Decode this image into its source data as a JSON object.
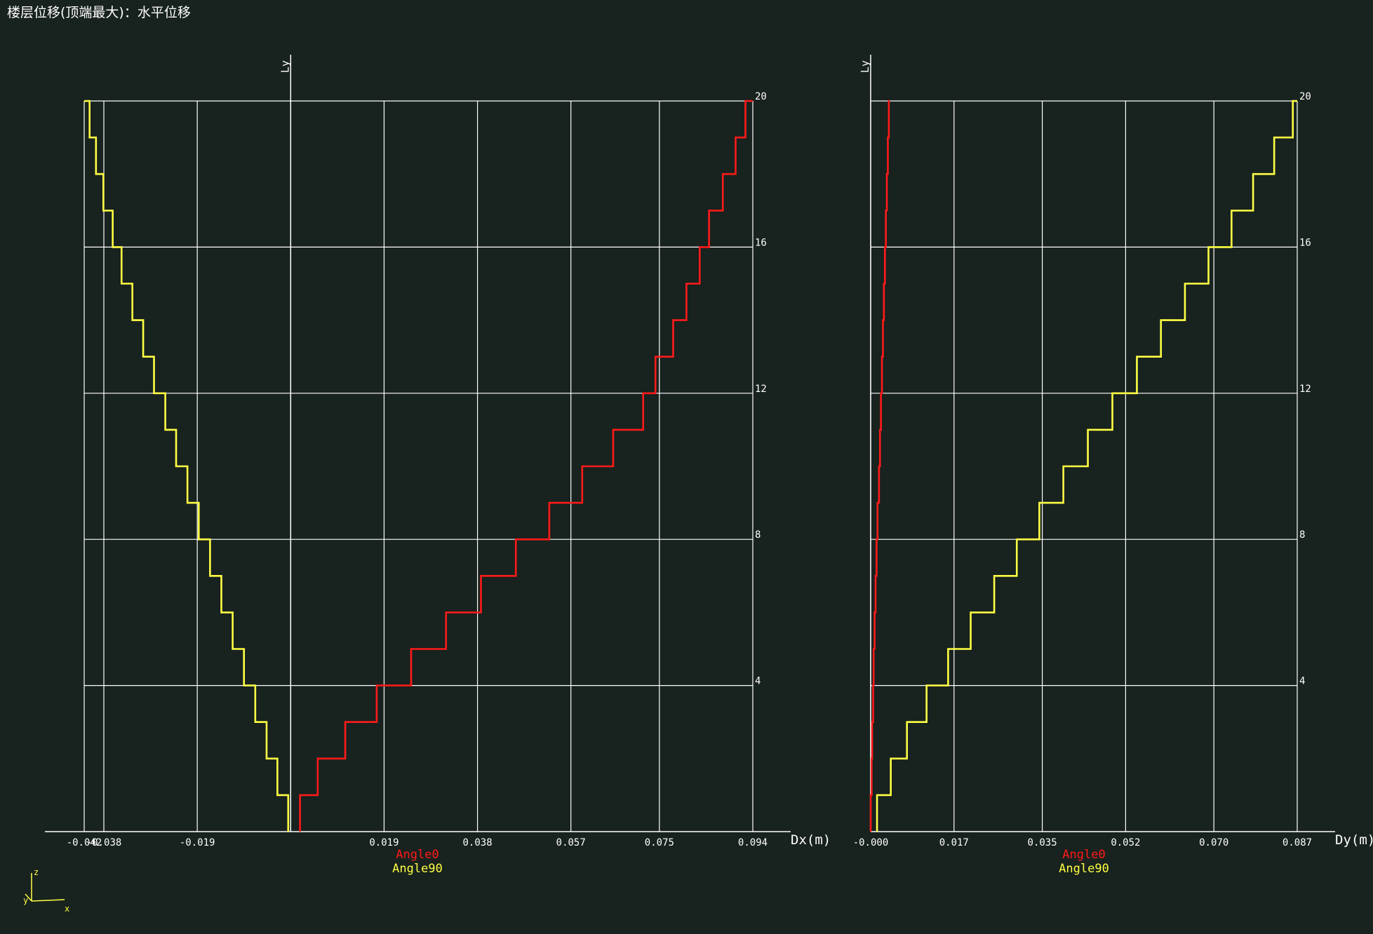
{
  "window": {
    "title": "楼层位移(顶端最大)：水平位移"
  },
  "colors": {
    "background": "#18221e",
    "grid": "#ffffff",
    "angle0": "#ff1a1a",
    "angle90": "#ffff44"
  },
  "axes_icon": {
    "z": "z",
    "y": "y",
    "x": "x"
  },
  "chart_data": [
    {
      "type": "line",
      "step": true,
      "xlabel": "Dx(m)",
      "ylabel": "Ly",
      "xlim": [
        -0.042,
        0.094
      ],
      "ylim": [
        0,
        20
      ],
      "xticks": [
        -0.042,
        -0.038,
        -0.019,
        0.019,
        0.038,
        0.057,
        0.075,
        0.094
      ],
      "xtick_labels": [
        "-0.042",
        "-0.038",
        "-0.019",
        "0.019",
        "0.038",
        "0.057",
        "0.075",
        "0.094"
      ],
      "xgrid": [
        -0.042,
        -0.038,
        -0.019,
        0,
        0.019,
        0.038,
        0.057,
        0.075,
        0.094
      ],
      "yticks": [
        4,
        8,
        12,
        16,
        20
      ],
      "ytick_labels": [
        "4",
        "8",
        "12",
        "16",
        "20"
      ],
      "legend": [
        "Angle0",
        "Angle90"
      ],
      "series": [
        {
          "name": "Angle0",
          "color": "#ff1a1a",
          "floor": [
            0,
            1,
            2,
            3,
            4,
            5,
            6,
            7,
            8,
            9,
            10,
            11,
            12,
            13,
            14,
            15,
            16,
            17,
            18,
            19,
            20
          ],
          "values": [
            0.0019,
            0.0055,
            0.0111,
            0.0175,
            0.0245,
            0.0316,
            0.0387,
            0.0458,
            0.0526,
            0.0593,
            0.0656,
            0.0717,
            0.0742,
            0.0778,
            0.0805,
            0.0832,
            0.0851,
            0.0879,
            0.0905,
            0.0925,
            0.094
          ]
        },
        {
          "name": "Angle90",
          "color": "#ffff44",
          "floor": [
            0,
            1,
            2,
            3,
            4,
            5,
            6,
            7,
            8,
            9,
            10,
            11,
            12,
            13,
            14,
            15,
            16,
            17,
            18,
            19,
            20
          ],
          "values": [
            -0.0005,
            -0.0027,
            -0.0049,
            -0.0072,
            -0.0095,
            -0.0118,
            -0.0141,
            -0.0164,
            -0.0187,
            -0.021,
            -0.0233,
            -0.0255,
            -0.0278,
            -0.03,
            -0.0322,
            -0.0344,
            -0.0362,
            -0.0381,
            -0.0396,
            -0.0409,
            -0.042
          ]
        }
      ]
    },
    {
      "type": "line",
      "step": true,
      "xlabel": "Dy(m)",
      "ylabel": "Ly",
      "xlim": [
        0,
        0.087
      ],
      "ylim": [
        0,
        20
      ],
      "xticks": [
        0,
        0.017,
        0.035,
        0.052,
        0.07,
        0.087
      ],
      "xtick_labels": [
        "-0.000",
        "0.017",
        "0.035",
        "0.052",
        "0.070",
        "0.087"
      ],
      "xgrid": [
        0,
        0.017,
        0.035,
        0.052,
        0.07,
        0.087
      ],
      "yticks": [
        4,
        8,
        12,
        16,
        20
      ],
      "ytick_labels": [
        "4",
        "8",
        "12",
        "16",
        "20"
      ],
      "legend": [
        "Angle0",
        "Angle90"
      ],
      "series": [
        {
          "name": "Angle0",
          "color": "#ff1a1a",
          "floor": [
            0,
            1,
            2,
            3,
            4,
            5,
            6,
            7,
            8,
            9,
            10,
            11,
            12,
            13,
            14,
            15,
            16,
            17,
            18,
            19,
            20
          ],
          "values": [
            0.0,
            0.0002,
            0.0003,
            0.0005,
            0.0006,
            0.0008,
            0.001,
            0.0012,
            0.0014,
            0.0017,
            0.0019,
            0.0021,
            0.0023,
            0.0025,
            0.0027,
            0.0029,
            0.0031,
            0.0033,
            0.0035,
            0.0037,
            0.0039
          ]
        },
        {
          "name": "Angle90",
          "color": "#ffff44",
          "floor": [
            0,
            1,
            2,
            3,
            4,
            5,
            6,
            7,
            8,
            9,
            10,
            11,
            12,
            13,
            14,
            15,
            16,
            17,
            18,
            19,
            20
          ],
          "values": [
            0.0013,
            0.0041,
            0.0074,
            0.0114,
            0.0158,
            0.0204,
            0.0252,
            0.0298,
            0.0344,
            0.0393,
            0.0443,
            0.0493,
            0.0543,
            0.0592,
            0.0641,
            0.0689,
            0.0736,
            0.078,
            0.0823,
            0.0861,
            0.087
          ]
        }
      ]
    }
  ]
}
